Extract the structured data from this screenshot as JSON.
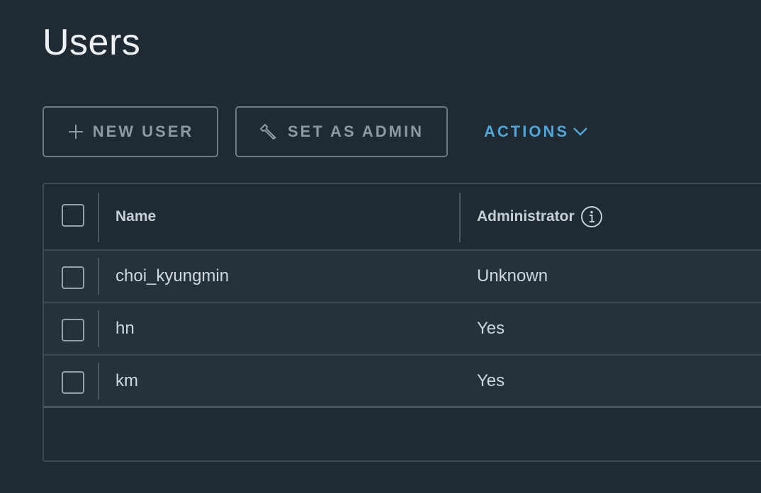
{
  "page": {
    "title": "Users"
  },
  "toolbar": {
    "new_user_label": "NEW USER",
    "new_user_icon": "plus-icon",
    "set_admin_label": "SET AS ADMIN",
    "set_admin_icon": "wrench-icon",
    "actions_label": "ACTIONS",
    "actions_icon": "chevron-down-icon",
    "accent_color": "#4fa6d8"
  },
  "table": {
    "columns": [
      {
        "label": "Name"
      },
      {
        "label": "Administrator",
        "icon": "info-icon"
      }
    ],
    "rows": [
      {
        "name": "choi_kyungmin",
        "administrator": "Unknown"
      },
      {
        "name": "hn",
        "administrator": "Yes"
      },
      {
        "name": "km",
        "administrator": "Yes"
      }
    ]
  }
}
